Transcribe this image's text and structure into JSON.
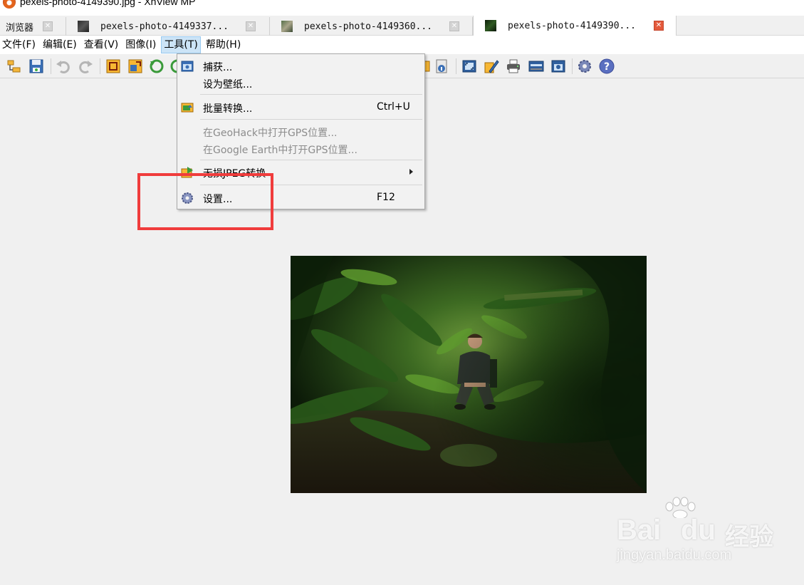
{
  "window": {
    "title": "pexels-photo-4149390.jpg - XnView MP"
  },
  "tabs": [
    {
      "label": "浏览器",
      "active": false
    },
    {
      "label": "pexels-photo-4149337...",
      "active": false
    },
    {
      "label": "pexels-photo-4149360...",
      "active": false
    },
    {
      "label": "pexels-photo-4149390...",
      "active": true
    }
  ],
  "menubar": {
    "items": [
      {
        "label": "文件(F)"
      },
      {
        "label": "编辑(E)"
      },
      {
        "label": "查看(V)"
      },
      {
        "label": "图像(I)"
      },
      {
        "label": "工具(T)",
        "open": true
      },
      {
        "label": "帮助(H)"
      }
    ]
  },
  "tools_menu": {
    "items": [
      {
        "label": "捕获...",
        "shortcut": "",
        "icon": "capture-icon"
      },
      {
        "label": "设为壁纸...",
        "shortcut": ""
      },
      {
        "label": "批量转换...",
        "shortcut": "Ctrl+U",
        "icon": "batch-convert-icon"
      },
      {
        "label": "在GeoHack中打开GPS位置...",
        "shortcut": "",
        "disabled": true
      },
      {
        "label": "在Google Earth中打开GPS位置...",
        "shortcut": "",
        "disabled": true
      },
      {
        "label": "无损JPEG转换",
        "shortcut": "",
        "submenu": true,
        "icon": "lossless-jpeg-icon"
      },
      {
        "label": "设置...",
        "shortcut": "F12",
        "icon": "settings-gear-icon"
      }
    ]
  },
  "toolbar": {
    "icons": [
      "open-folder-icon",
      "save-icon",
      "undo-icon",
      "redo-icon",
      "crop-icon",
      "resize-icon",
      "rotate-left-icon",
      "rotate-right-icon",
      "copy-icon",
      "info-icon",
      "fit-window-icon",
      "edit-icon",
      "print-icon",
      "scanner-icon",
      "screenshot-icon",
      "settings-icon",
      "help-icon"
    ]
  },
  "watermark": {
    "brand": "Bai",
    "brand2": "du",
    "cn": "经验",
    "url": "jingyan.baidu.com"
  },
  "colors": {
    "menu_open_bg": "#cce4f7",
    "highlight_box": "#f03c3c",
    "active_tab_close": "#e45a3c"
  }
}
